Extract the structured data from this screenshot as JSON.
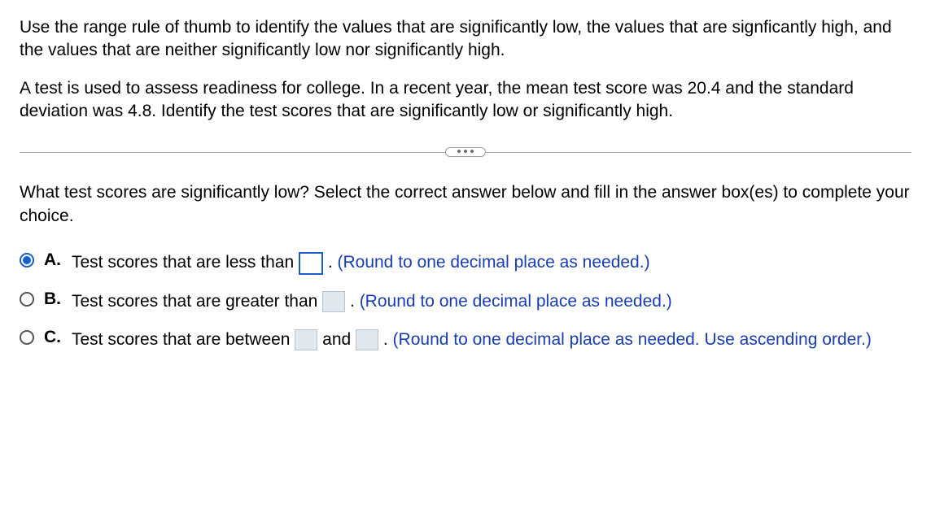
{
  "instruction": "Use the range rule of thumb to identify the values that are significantly low, the values that are signficantly high, and the values that are neither significantly low nor significantly high.",
  "problem": "A test is used to assess readiness for college. In a recent year, the mean test score was 20.4 and the standard deviation was 4.8. Identify the test scores that are significantly low or significantly high.",
  "question": "What test scores are significantly low? Select the correct answer below and fill in the answer box(es) to complete your choice.",
  "options": {
    "a": {
      "label": "A.",
      "text_before": "Test scores that are less than ",
      "text_after": ". ",
      "hint": "(Round to one decimal place as needed.)"
    },
    "b": {
      "label": "B.",
      "text_before": "Test scores that are greater than ",
      "text_after": ". ",
      "hint": "(Round to one decimal place as needed.)"
    },
    "c": {
      "label": "C.",
      "text_before": "Test scores that are between ",
      "and": " and ",
      "text_after": ". ",
      "hint": "(Round to one decimal place as needed. Use ascending order.)"
    }
  }
}
